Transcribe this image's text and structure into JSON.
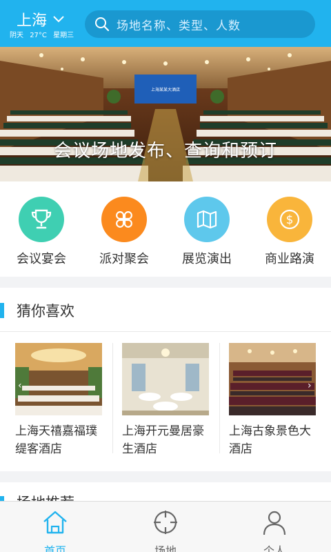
{
  "header": {
    "city": "上海",
    "weather": {
      "condition": "阴天",
      "temperature": "27°C",
      "weekday": "星期三"
    },
    "search_placeholder": "场地名称、类型、人数",
    "bg_color": "#21b3ee"
  },
  "banner": {
    "caption": "会议场地发布、查询和预订",
    "stage_sign": "上海某某大酒店"
  },
  "categories": [
    {
      "label": "会议宴会",
      "icon": "trophy-icon",
      "color": "#3fcfb2"
    },
    {
      "label": "派对聚会",
      "icon": "clover-icon",
      "color": "#fb8a1e"
    },
    {
      "label": "展览演出",
      "icon": "map-icon",
      "color": "#5ec8ec"
    },
    {
      "label": "商业路演",
      "icon": "dollar-icon",
      "color": "#f9b53b"
    }
  ],
  "recommend": {
    "title": "猜你喜欢",
    "items": [
      {
        "name": "上海天禧嘉福璞缇客酒店"
      },
      {
        "name": "上海开元曼居豪生酒店"
      },
      {
        "name": "上海古象景色大酒店"
      }
    ]
  },
  "next_section": {
    "title": "场地推荐"
  },
  "tabbar": {
    "items": [
      {
        "label": "首页",
        "icon": "home-icon",
        "active": true
      },
      {
        "label": "场地",
        "icon": "crosshair-icon",
        "active": false
      },
      {
        "label": "个人",
        "icon": "person-icon",
        "active": false
      }
    ],
    "active_color": "#21b3ee",
    "inactive_color": "#666666"
  }
}
